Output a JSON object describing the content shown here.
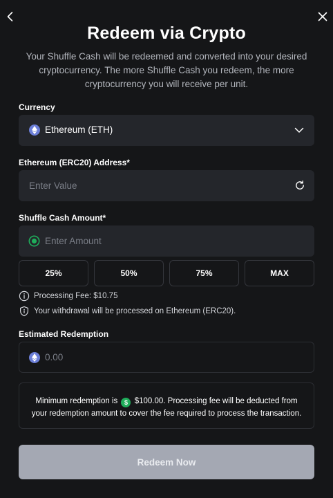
{
  "header": {
    "title": "Redeem via Crypto",
    "description": "Your Shuffle Cash will be redeemed and converted into your desired cryptocurrency. The more Shuffle Cash you redeem, the more cryptocurrency you will receive per unit."
  },
  "currency": {
    "label": "Currency",
    "selected": "Ethereum (ETH)",
    "icon": "ethereum-icon",
    "color": "#6c7fd8"
  },
  "address": {
    "label": "Ethereum (ERC20) Address*",
    "placeholder": "Enter Value",
    "value": ""
  },
  "amount": {
    "label": "Shuffle Cash Amount*",
    "placeholder": "Enter Amount",
    "value": "",
    "percent_buttons": [
      "25%",
      "50%",
      "75%",
      "MAX"
    ]
  },
  "info": {
    "processing_fee": "Processing Fee: $10.75",
    "network_note": "Your withdrawal will be processed on Ethereum (ERC20)."
  },
  "estimate": {
    "label": "Estimated Redemption",
    "value": "0.00"
  },
  "notice": {
    "prefix": "Minimum redemption is",
    "currency_symbol": "$",
    "amount": "$100.00",
    "suffix": ". Processing fee will be deducted from your redemption amount to cover the fee required to process the transaction.",
    "badge_color": "#1fae5b"
  },
  "actions": {
    "submit_label": "Redeem Now"
  },
  "colors": {
    "background": "#151618",
    "field": "#24262b",
    "accent_green": "#1fae5b",
    "button_disabled": "#a4a8b3"
  }
}
